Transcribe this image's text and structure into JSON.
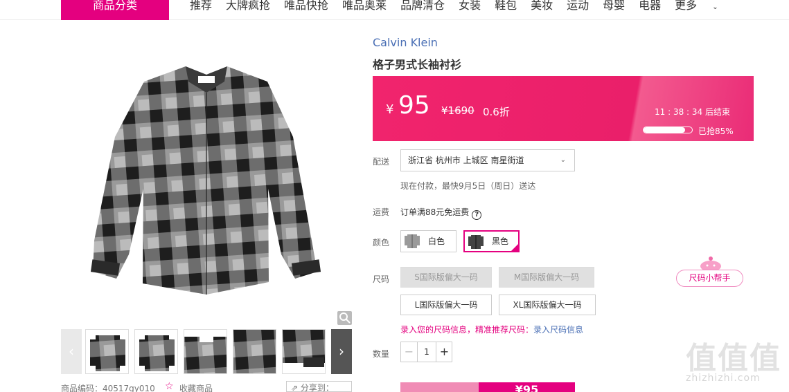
{
  "nav": {
    "category_button": "商品分类",
    "items": [
      "推荐",
      "大牌疯抢",
      "唯品快抢",
      "唯品奥莱",
      "品牌清仓",
      "女装",
      "鞋包",
      "美妆",
      "运动",
      "母婴",
      "电器",
      "更多"
    ]
  },
  "product": {
    "brand": "Calvin Klein",
    "title": "格子男式长袖衬衫",
    "code_label": "商品编码：40517gy010",
    "favorite_label": "收藏商品",
    "share_label": "分享到："
  },
  "price": {
    "currency": "¥",
    "current": "95",
    "original": "¥1690",
    "discount": "0.6折",
    "countdown": "11 : 38 : 34  后结束",
    "sold_progress_percent": 85,
    "sold_text": "已抢85%"
  },
  "delivery": {
    "label": "配送",
    "address": "浙江省 杭州市 上城区 南星街道",
    "note": "现在付款，最快9月5日（周日）送达"
  },
  "freight": {
    "label": "运费",
    "text": "订单满88元免运费",
    "help": "?"
  },
  "colors": {
    "label": "颜色",
    "options": [
      {
        "name": "白色",
        "selected": false
      },
      {
        "name": "黑色",
        "selected": true
      }
    ]
  },
  "sizes": {
    "label": "尺码",
    "options": [
      {
        "name": "S国际版偏大一码",
        "available": false
      },
      {
        "name": "M国际版偏大一码",
        "available": false
      },
      {
        "name": "L国际版偏大一码",
        "available": true
      },
      {
        "name": "XL国际版偏大一码",
        "available": true
      }
    ],
    "helper": "尺码小帮手",
    "recommend_text": "录入您的尺码信息，精准推荐尺码：",
    "recommend_link": "录入尺码信息"
  },
  "quantity": {
    "label": "数量",
    "value": "1",
    "minus": "−",
    "plus": "+"
  },
  "buy": {
    "price_label": "¥95"
  },
  "watermark": {
    "logo": "值值值",
    "site": "zhizhizhi.com"
  },
  "colors_theme": {
    "accent": "#e4007f",
    "banner": "#ea1f6a",
    "brand_link": "#4a6fb5"
  }
}
